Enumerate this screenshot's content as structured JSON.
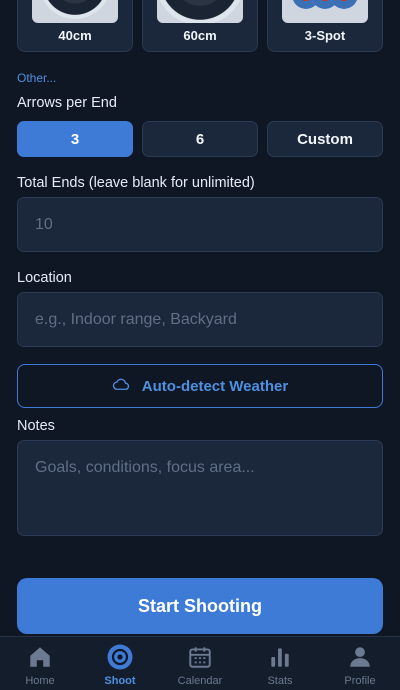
{
  "targets": [
    {
      "label": "40cm"
    },
    {
      "label": "60cm"
    },
    {
      "label": "3-Spot"
    }
  ],
  "other_link": "Other...",
  "arrows_per_end": {
    "label": "Arrows per End",
    "options": [
      "3",
      "6",
      "Custom"
    ],
    "selected": "3"
  },
  "total_ends": {
    "label": "Total Ends (leave blank for unlimited)",
    "placeholder": "10",
    "value": ""
  },
  "location": {
    "label": "Location",
    "placeholder": "e.g., Indoor range, Backyard",
    "value": ""
  },
  "weather_button": {
    "label": "Auto-detect Weather",
    "icon": "cloud-icon"
  },
  "notes": {
    "label": "Notes",
    "placeholder": "Goals, conditions, focus area...",
    "value": ""
  },
  "start_button": {
    "label": "Start Shooting"
  },
  "tabbar": {
    "items": [
      {
        "label": "Home",
        "icon": "home-icon",
        "active": false
      },
      {
        "label": "Shoot",
        "icon": "target-icon",
        "active": true
      },
      {
        "label": "Calendar",
        "icon": "calendar-icon",
        "active": false
      },
      {
        "label": "Stats",
        "icon": "bar-chart-icon",
        "active": false
      },
      {
        "label": "Profile",
        "icon": "person-icon",
        "active": false
      }
    ]
  },
  "colors": {
    "background": "#0f1724",
    "card": "#1b273a",
    "accent": "#3d7bd6",
    "link": "#4f8fe0"
  }
}
